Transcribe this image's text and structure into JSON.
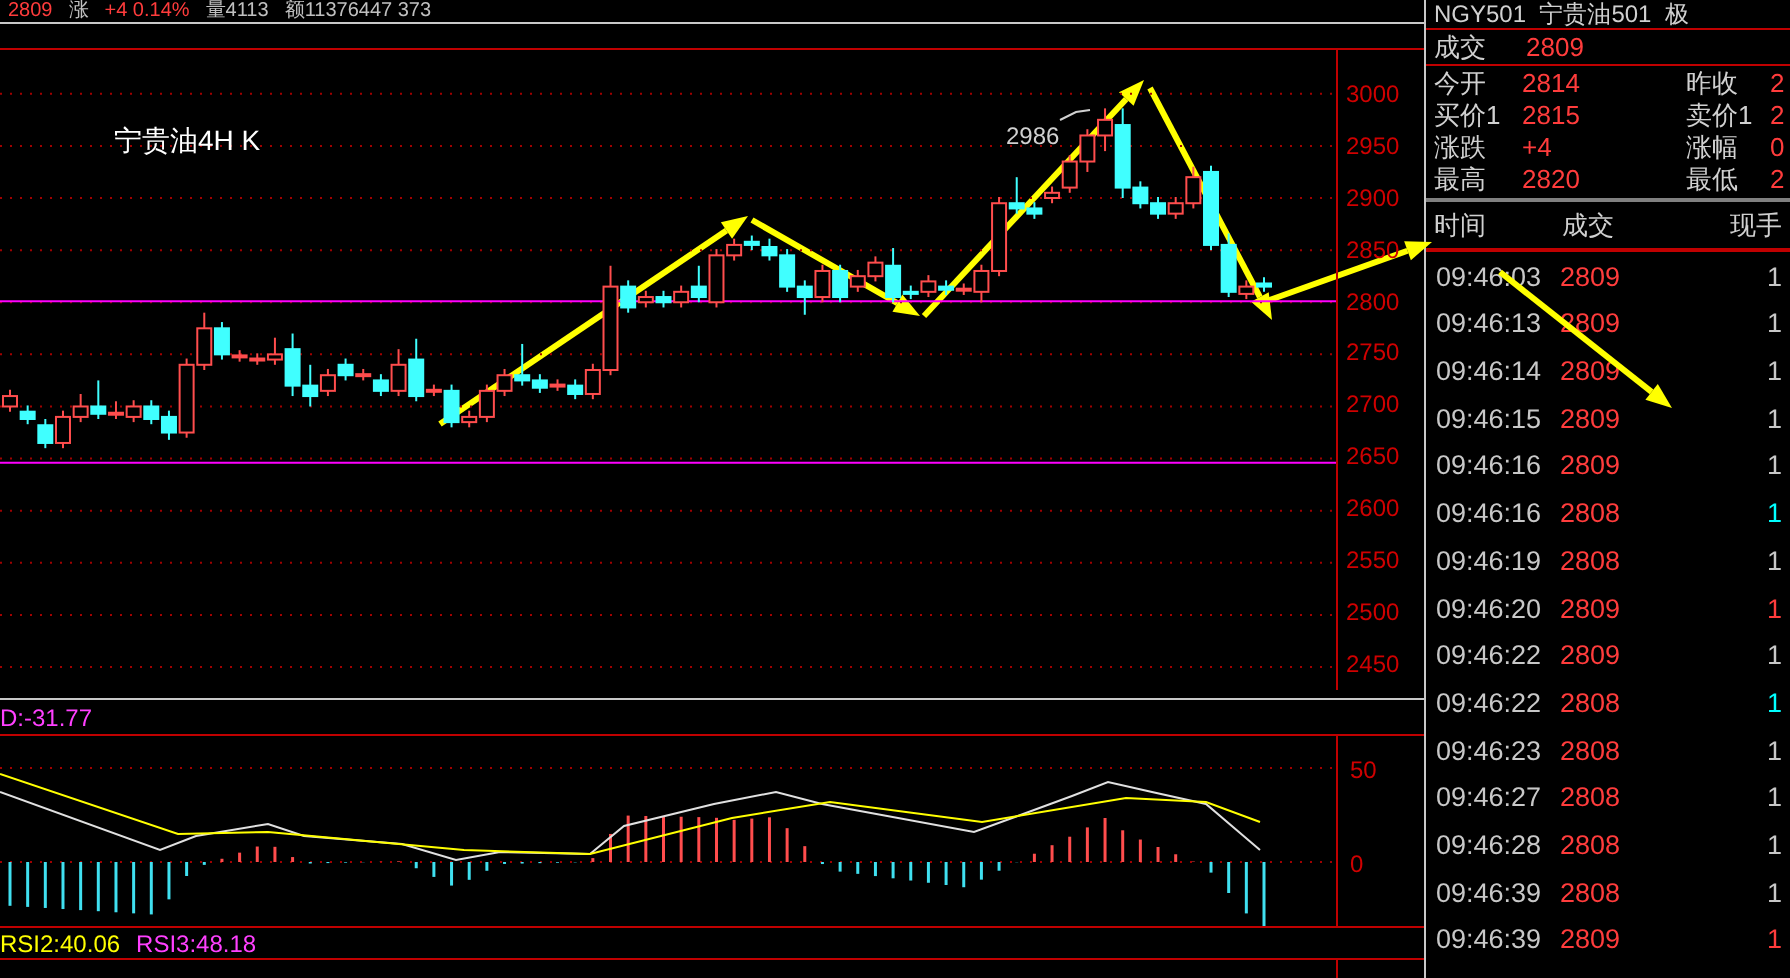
{
  "quote_bar": [
    {
      "kind": "up",
      "text": "2809"
    },
    {
      "kind": "label",
      "text": "涨"
    },
    {
      "kind": "up",
      "text": "+4 0.14%"
    },
    {
      "kind": "label",
      "text": "量4113"
    },
    {
      "kind": "label",
      "text": "额11376447 373"
    }
  ],
  "chart": {
    "title": "宁贵油4H K",
    "peak_label": "2986",
    "chart_data": {
      "type": "candlestick",
      "grid": true,
      "ref_lines": [
        {
          "axis": "y",
          "value": 2801,
          "color": "#ff00ff"
        },
        {
          "axis": "y",
          "value": 2646,
          "color": "#ff00ff"
        }
      ],
      "ylim": [
        2428,
        3042
      ],
      "yticks": [
        3000,
        2950,
        2900,
        2850,
        2800,
        2750,
        2700,
        2650,
        2600,
        2550,
        2500,
        2450
      ],
      "ohlc": [
        [
          2700,
          2716,
          2695,
          2710
        ],
        [
          2695,
          2701,
          2683,
          2688
        ],
        [
          2682,
          2688,
          2660,
          2665
        ],
        [
          2665,
          2696,
          2660,
          2690
        ],
        [
          2690,
          2712,
          2685,
          2700
        ],
        [
          2700,
          2725,
          2688,
          2693
        ],
        [
          2693,
          2705,
          2688,
          2694
        ],
        [
          2690,
          2706,
          2685,
          2700
        ],
        [
          2700,
          2706,
          2683,
          2688
        ],
        [
          2690,
          2696,
          2668,
          2675
        ],
        [
          2675,
          2746,
          2670,
          2740
        ],
        [
          2740,
          2790,
          2735,
          2775
        ],
        [
          2775,
          2781,
          2745,
          2750
        ],
        [
          2748,
          2754,
          2743,
          2749
        ],
        [
          2745,
          2751,
          2740,
          2746
        ],
        [
          2745,
          2766,
          2740,
          2750
        ],
        [
          2755,
          2770,
          2710,
          2720
        ],
        [
          2720,
          2740,
          2700,
          2710
        ],
        [
          2715,
          2736,
          2710,
          2730
        ],
        [
          2740,
          2746,
          2725,
          2730
        ],
        [
          2730,
          2736,
          2725,
          2731
        ],
        [
          2725,
          2731,
          2710,
          2715
        ],
        [
          2715,
          2755,
          2710,
          2740
        ],
        [
          2745,
          2765,
          2705,
          2710
        ],
        [
          2715,
          2721,
          2710,
          2716
        ],
        [
          2715,
          2721,
          2680,
          2685
        ],
        [
          2685,
          2696,
          2680,
          2690
        ],
        [
          2690,
          2721,
          2685,
          2715
        ],
        [
          2715,
          2736,
          2710,
          2730
        ],
        [
          2730,
          2760,
          2720,
          2725
        ],
        [
          2725,
          2731,
          2713,
          2718
        ],
        [
          2720,
          2726,
          2715,
          2721
        ],
        [
          2720,
          2726,
          2707,
          2712
        ],
        [
          2712,
          2741,
          2707,
          2735
        ],
        [
          2735,
          2835,
          2730,
          2815
        ],
        [
          2815,
          2821,
          2790,
          2795
        ],
        [
          2800,
          2811,
          2795,
          2805
        ],
        [
          2805,
          2811,
          2795,
          2800
        ],
        [
          2800,
          2816,
          2795,
          2810
        ],
        [
          2815,
          2835,
          2800,
          2805
        ],
        [
          2800,
          2851,
          2795,
          2845
        ],
        [
          2845,
          2861,
          2840,
          2855
        ],
        [
          2858,
          2864,
          2850,
          2855
        ],
        [
          2853,
          2861,
          2840,
          2845
        ],
        [
          2845,
          2851,
          2810,
          2815
        ],
        [
          2815,
          2821,
          2788,
          2805
        ],
        [
          2805,
          2836,
          2800,
          2830
        ],
        [
          2830,
          2836,
          2800,
          2805
        ],
        [
          2815,
          2831,
          2810,
          2825
        ],
        [
          2825,
          2844,
          2820,
          2838
        ],
        [
          2835,
          2852,
          2800,
          2805
        ],
        [
          2810,
          2816,
          2803,
          2808
        ],
        [
          2810,
          2826,
          2805,
          2820
        ],
        [
          2815,
          2821,
          2807,
          2812
        ],
        [
          2812,
          2818,
          2807,
          2813
        ],
        [
          2810,
          2836,
          2800,
          2830
        ],
        [
          2830,
          2901,
          2825,
          2895
        ],
        [
          2895,
          2920,
          2885,
          2890
        ],
        [
          2890,
          2896,
          2880,
          2885
        ],
        [
          2900,
          2911,
          2895,
          2905
        ],
        [
          2910,
          2941,
          2905,
          2935
        ],
        [
          2935,
          2966,
          2925,
          2960
        ],
        [
          2960,
          2986,
          2945,
          2975
        ],
        [
          2970,
          2986,
          2900,
          2910
        ],
        [
          2910,
          2916,
          2890,
          2895
        ],
        [
          2895,
          2901,
          2880,
          2885
        ],
        [
          2885,
          2901,
          2880,
          2895
        ],
        [
          2895,
          2930,
          2890,
          2920
        ],
        [
          2925,
          2931,
          2850,
          2855
        ],
        [
          2855,
          2866,
          2805,
          2810
        ],
        [
          2808,
          2821,
          2803,
          2815
        ],
        [
          2818,
          2824,
          2810,
          2815
        ]
      ]
    }
  },
  "macd": {
    "label": "D:-31.77",
    "ticks": [
      "50",
      "0"
    ]
  },
  "rsi": {
    "labels": [
      {
        "kind": "rsi2",
        "text": "RSI2:40.06"
      },
      {
        "kind": "rsi3",
        "text": "RSI3:48.18"
      }
    ]
  },
  "panel": {
    "header": "NGY501  宁贵油501  极",
    "last": {
      "label": "成交",
      "value": "2809"
    },
    "stats": [
      {
        "label": "今开",
        "value": "2814"
      },
      {
        "label": "昨收",
        "value": "2"
      },
      {
        "label": "买价1",
        "value": "2815"
      },
      {
        "label": "卖价1",
        "value": "2"
      },
      {
        "label": "涨跌",
        "value": "+4"
      },
      {
        "label": "涨幅",
        "value": "0"
      },
      {
        "label": "最高",
        "value": "2820"
      },
      {
        "label": "最低",
        "value": "2"
      }
    ],
    "trade_columns": [
      "时间",
      "成交",
      "现手"
    ],
    "trades": [
      {
        "time": "09:46:03",
        "price": "2809",
        "volume": "1",
        "color": "#c8c8c8"
      },
      {
        "time": "09:46:13",
        "price": "2809",
        "volume": "1",
        "color": "#c8c8c8"
      },
      {
        "time": "09:46:14",
        "price": "2809",
        "volume": "1",
        "color": "#c8c8c8"
      },
      {
        "time": "09:46:15",
        "price": "2809",
        "volume": "1",
        "color": "#c8c8c8"
      },
      {
        "time": "09:46:16",
        "price": "2809",
        "volume": "1",
        "color": "#c8c8c8"
      },
      {
        "time": "09:46:16",
        "price": "2808",
        "volume": "1",
        "color": "#00ffff"
      },
      {
        "time": "09:46:19",
        "price": "2808",
        "volume": "1",
        "color": "#c8c8c8"
      },
      {
        "time": "09:46:20",
        "price": "2809",
        "volume": "1",
        "color": "#ff3c3c"
      },
      {
        "time": "09:46:22",
        "price": "2809",
        "volume": "1",
        "color": "#c8c8c8"
      },
      {
        "time": "09:46:22",
        "price": "2808",
        "volume": "1",
        "color": "#00ffff"
      },
      {
        "time": "09:46:23",
        "price": "2808",
        "volume": "1",
        "color": "#c8c8c8"
      },
      {
        "time": "09:46:27",
        "price": "2808",
        "volume": "1",
        "color": "#c8c8c8"
      },
      {
        "time": "09:46:28",
        "price": "2808",
        "volume": "1",
        "color": "#c8c8c8"
      },
      {
        "time": "09:46:39",
        "price": "2808",
        "volume": "1",
        "color": "#c8c8c8"
      },
      {
        "time": "09:46:39",
        "price": "2809",
        "volume": "1",
        "color": "#ff3c3c"
      }
    ]
  }
}
